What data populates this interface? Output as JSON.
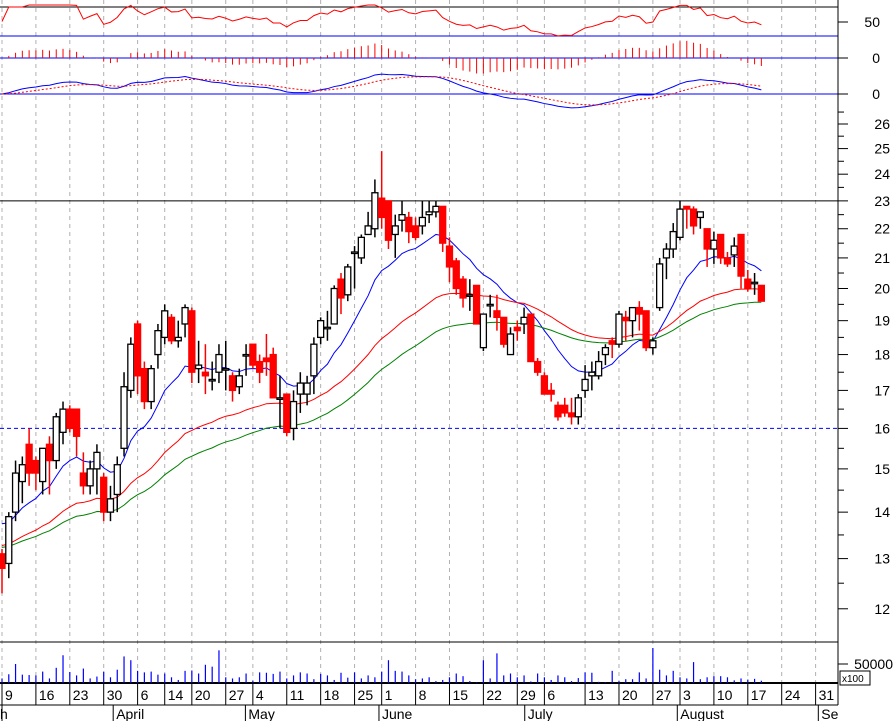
{
  "chart_data": {
    "type": "candlestick",
    "price_scale": "log",
    "ylim": [
      11.6,
      26.2
    ],
    "y_ticks": [
      12,
      13,
      14,
      15,
      16,
      17,
      18,
      19,
      20,
      21,
      22,
      23,
      24,
      25,
      26
    ],
    "reference_lines": {
      "resistance": 23,
      "support": 16
    },
    "ohlc": [
      [
        13.1,
        13.2,
        12.3,
        12.8
      ],
      [
        12.9,
        14.0,
        12.6,
        13.9
      ],
      [
        14.0,
        15.2,
        13.8,
        14.9
      ],
      [
        14.7,
        15.3,
        14.2,
        15.1
      ],
      [
        15.6,
        16.0,
        14.6,
        14.9
      ],
      [
        15.2,
        15.3,
        14.5,
        14.9
      ],
      [
        14.7,
        15.5,
        14.4,
        15.5
      ],
      [
        15.6,
        15.8,
        14.4,
        15.2
      ],
      [
        15.2,
        16.4,
        15.0,
        16.3
      ],
      [
        15.9,
        16.7,
        15.6,
        16.5
      ],
      [
        16.5,
        16.6,
        15.9,
        16.0
      ],
      [
        16.5,
        16.5,
        15.3,
        15.8
      ],
      [
        14.9,
        15.4,
        14.4,
        14.6
      ],
      [
        14.6,
        15.2,
        14.4,
        15.0
      ],
      [
        15.0,
        15.6,
        14.4,
        15.4
      ],
      [
        14.8,
        14.9,
        13.8,
        14.0
      ],
      [
        14.0,
        14.6,
        13.8,
        14.3
      ],
      [
        14.4,
        15.3,
        14.0,
        15.1
      ],
      [
        15.5,
        17.5,
        15.3,
        17.1
      ],
      [
        17.0,
        18.5,
        16.8,
        18.3
      ],
      [
        18.9,
        19.0,
        16.9,
        17.4
      ],
      [
        17.6,
        17.8,
        16.5,
        16.7
      ],
      [
        16.7,
        17.7,
        16.5,
        17.6
      ],
      [
        18.0,
        18.9,
        17.6,
        18.7
      ],
      [
        18.5,
        19.5,
        18.3,
        19.3
      ],
      [
        19.1,
        19.2,
        18.3,
        18.4
      ],
      [
        18.4,
        19.0,
        18.2,
        18.5
      ],
      [
        18.9,
        19.5,
        18.5,
        19.4
      ],
      [
        19.3,
        19.4,
        17.2,
        17.5
      ],
      [
        17.6,
        18.4,
        17.2,
        17.7
      ],
      [
        17.5,
        18.3,
        16.9,
        17.4
      ],
      [
        17.3,
        17.8,
        17.0,
        17.3
      ],
      [
        17.5,
        18.3,
        17.2,
        18.0
      ],
      [
        17.6,
        18.4,
        17.0,
        17.6
      ],
      [
        17.4,
        17.5,
        16.7,
        17.0
      ],
      [
        17.1,
        17.6,
        16.9,
        17.4
      ],
      [
        18.0,
        18.3,
        17.4,
        18.0
      ],
      [
        18.3,
        18.3,
        17.6,
        17.7
      ],
      [
        17.8,
        18.0,
        17.2,
        17.5
      ],
      [
        17.9,
        18.6,
        17.4,
        17.8
      ],
      [
        18.0,
        18.2,
        16.9,
        16.8
      ],
      [
        16.8,
        17.4,
        16.0,
        16.8
      ],
      [
        16.9,
        16.9,
        15.8,
        15.9
      ],
      [
        16.0,
        17.0,
        15.7,
        16.7
      ],
      [
        16.9,
        17.5,
        16.4,
        17.2
      ],
      [
        16.9,
        17.4,
        16.6,
        17.2
      ],
      [
        17.4,
        18.5,
        16.9,
        18.3
      ],
      [
        18.5,
        19.1,
        18.3,
        19.0
      ],
      [
        18.8,
        19.3,
        18.4,
        18.8
      ],
      [
        18.9,
        20.1,
        18.9,
        20.0
      ],
      [
        20.3,
        20.5,
        19.2,
        19.7
      ],
      [
        19.8,
        20.8,
        19.6,
        20.7
      ],
      [
        21.2,
        21.4,
        20.0,
        21.2
      ],
      [
        21.0,
        21.8,
        20.8,
        21.7
      ],
      [
        21.8,
        22.6,
        21.8,
        22.1
      ],
      [
        22.0,
        23.8,
        21.7,
        23.3
      ],
      [
        23.1,
        24.9,
        22.0,
        22.4
      ],
      [
        23.0,
        23.0,
        21.3,
        21.6
      ],
      [
        21.8,
        22.5,
        21.0,
        22.1
      ],
      [
        22.3,
        23.0,
        21.9,
        22.5
      ],
      [
        22.4,
        22.6,
        21.5,
        21.9
      ],
      [
        22.1,
        22.4,
        21.6,
        21.7
      ],
      [
        22.1,
        23.0,
        21.8,
        22.4
      ],
      [
        22.5,
        23.0,
        22.2,
        22.6
      ],
      [
        22.6,
        23.0,
        22.4,
        22.8
      ],
      [
        22.8,
        22.8,
        21.2,
        21.5
      ],
      [
        21.4,
        21.7,
        20.2,
        20.7
      ],
      [
        20.9,
        21.0,
        19.8,
        20.0
      ],
      [
        20.3,
        20.4,
        19.4,
        19.7
      ],
      [
        19.8,
        20.3,
        19.3,
        19.8
      ],
      [
        20.1,
        20.1,
        18.9,
        18.9
      ],
      [
        18.2,
        19.2,
        18.1,
        19.2
      ],
      [
        19.5,
        19.8,
        19.1,
        19.5
      ],
      [
        19.3,
        19.8,
        18.7,
        19.1
      ],
      [
        19.1,
        19.1,
        18.2,
        18.3
      ],
      [
        18.0,
        18.8,
        18.0,
        18.6
      ],
      [
        18.8,
        19.0,
        18.4,
        18.7
      ],
      [
        18.9,
        19.4,
        18.6,
        19.1
      ],
      [
        19.2,
        19.2,
        17.8,
        17.8
      ],
      [
        17.8,
        17.9,
        17.4,
        17.5
      ],
      [
        17.4,
        17.5,
        16.9,
        16.9
      ],
      [
        17.0,
        17.2,
        16.7,
        16.9
      ],
      [
        16.6,
        16.7,
        16.2,
        16.3
      ],
      [
        16.6,
        16.8,
        16.3,
        16.4
      ],
      [
        16.4,
        16.8,
        16.1,
        16.3
      ],
      [
        16.3,
        16.9,
        16.1,
        16.8
      ],
      [
        17.0,
        17.7,
        16.8,
        17.3
      ],
      [
        17.4,
        17.8,
        17.0,
        17.5
      ],
      [
        17.4,
        18.1,
        17.3,
        17.8
      ],
      [
        18.0,
        18.3,
        17.7,
        18.2
      ],
      [
        18.4,
        18.5,
        17.9,
        18.3
      ],
      [
        18.3,
        19.3,
        18.2,
        19.2
      ],
      [
        19.1,
        19.3,
        18.4,
        19.0
      ],
      [
        19.0,
        19.4,
        18.5,
        19.4
      ],
      [
        19.4,
        19.6,
        18.7,
        19.2
      ],
      [
        19.3,
        19.3,
        18.1,
        18.2
      ],
      [
        18.2,
        18.5,
        18.0,
        18.4
      ],
      [
        19.4,
        21.0,
        19.3,
        20.8
      ],
      [
        21.0,
        21.5,
        20.3,
        21.3
      ],
      [
        21.3,
        22.2,
        21.0,
        21.9
      ],
      [
        21.7,
        23.0,
        21.6,
        22.7
      ],
      [
        22.8,
        22.8,
        22.0,
        22.7
      ],
      [
        22.7,
        22.8,
        21.8,
        22.1
      ],
      [
        22.4,
        22.6,
        22.0,
        22.6
      ],
      [
        22.0,
        22.0,
        20.7,
        21.3
      ],
      [
        21.3,
        21.9,
        20.8,
        21.6
      ],
      [
        21.8,
        21.8,
        20.8,
        21.0
      ],
      [
        21.0,
        21.2,
        20.7,
        20.8
      ],
      [
        21.1,
        21.7,
        20.7,
        21.4
      ],
      [
        21.8,
        21.8,
        20.0,
        20.4
      ],
      [
        20.3,
        20.6,
        19.9,
        20.0
      ],
      [
        20.2,
        20.5,
        19.8,
        20.2
      ],
      [
        20.1,
        20.1,
        19.6,
        19.6
      ]
    ],
    "volume": [
      12000,
      23000,
      50000,
      22000,
      21000,
      20000,
      30000,
      12000,
      40000,
      73000,
      29000,
      20000,
      38000,
      12000,
      17000,
      30000,
      15000,
      35000,
      70000,
      60000,
      32000,
      28000,
      30000,
      22000,
      25000,
      15000,
      8000,
      32000,
      33000,
      25000,
      48000,
      43000,
      86000,
      15000,
      12000,
      15000,
      25000,
      6000,
      28000,
      27000,
      24000,
      30000,
      12000,
      20000,
      28000,
      25000,
      10000,
      24000,
      20000,
      8000,
      27000,
      14000,
      28000,
      12000,
      20000,
      15000,
      30000,
      60000,
      32000,
      30000,
      20000,
      10000,
      12000,
      15000,
      5000,
      8000,
      15000,
      25000,
      18000,
      5000,
      2000,
      60000,
      12000,
      78000,
      20000,
      25000,
      15000,
      20000,
      4000,
      25000,
      15000,
      8000,
      20000,
      15000,
      5000,
      13000,
      28000,
      27000,
      3000,
      2000,
      32000,
      5000,
      10000,
      10000,
      28000,
      12000,
      92000,
      35000,
      20000,
      32000,
      15000,
      12000,
      55000,
      10000,
      15000,
      18000,
      18000,
      15000,
      7000,
      12000,
      9000,
      11000,
      6000
    ],
    "volume_axis": {
      "tick_label": "50000",
      "tick_value": 50000,
      "unit_label": "x100"
    },
    "indicator_labels": {
      "oscillator": "50",
      "histogram": "0",
      "macd": "0"
    },
    "x_ticks": {
      "day_index": [
        0,
        5,
        10,
        15,
        20,
        24,
        28,
        33,
        37,
        42,
        47,
        52,
        56,
        61,
        66,
        71,
        76,
        80,
        86,
        91,
        96,
        100,
        105,
        110,
        115,
        120
      ],
      "labels": [
        "9",
        "16",
        "23",
        "30",
        "6",
        "14",
        "20",
        "27",
        "4",
        "11",
        "18",
        "25",
        "1",
        "8",
        "15",
        "22",
        "29",
        "6",
        "13",
        "20",
        "27",
        "3",
        "10",
        "17",
        "24",
        "31"
      ]
    },
    "months": {
      "day_index": [
        0,
        16.4,
        35.9,
        55.6,
        77.1,
        99.6,
        120.4
      ],
      "labels": [
        "h",
        "April",
        "May",
        "June",
        "July",
        "August",
        "Se"
      ]
    },
    "colors": {
      "up": "#ffffff",
      "down": "#ff0000",
      "ma_fast": "#0000ff",
      "ma_mid": "#ff0000",
      "ma_slow": "#008000",
      "ref": "#0000ff",
      "grid": "#b0b0b0"
    }
  }
}
